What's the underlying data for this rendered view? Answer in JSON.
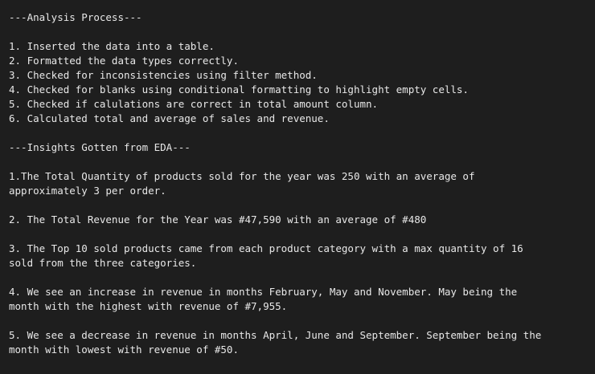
{
  "text_output": {
    "analysis_header": "---Analysis Process---",
    "steps": [
      "1. Inserted the data into a table.",
      "2. Formatted the data types correctly.",
      "3. Checked for inconsistencies using filter method.",
      "4. Checked for blanks using conditional formatting to highlight empty cells.",
      "5. Checked if calulations are correct in total amount column.",
      "6. Calculated total and average of sales and revenue."
    ],
    "insights_header": "---Insights Gotten from EDA---",
    "insights": [
      {
        "line1": "1.The Total Quantity of products sold for the year was 250 with an average of",
        "line2": "approximately 3 per order."
      },
      {
        "line1": "2. The Total Revenue for the Year was #47,590 with an average of #480",
        "line2": ""
      },
      {
        "line1": "3. The Top 10 sold products came from each product category with a max quantity of 16",
        "line2": "sold from the three categories."
      },
      {
        "line1": "4. We see an increase in revenue in months February, May and November. May being the",
        "line2": "month with the highest with revenue of #7,955."
      },
      {
        "line1": "5. We see a decrease in revenue in months April, June and September. September being the",
        "line2": "month with lowest with revenue of #50."
      }
    ]
  }
}
